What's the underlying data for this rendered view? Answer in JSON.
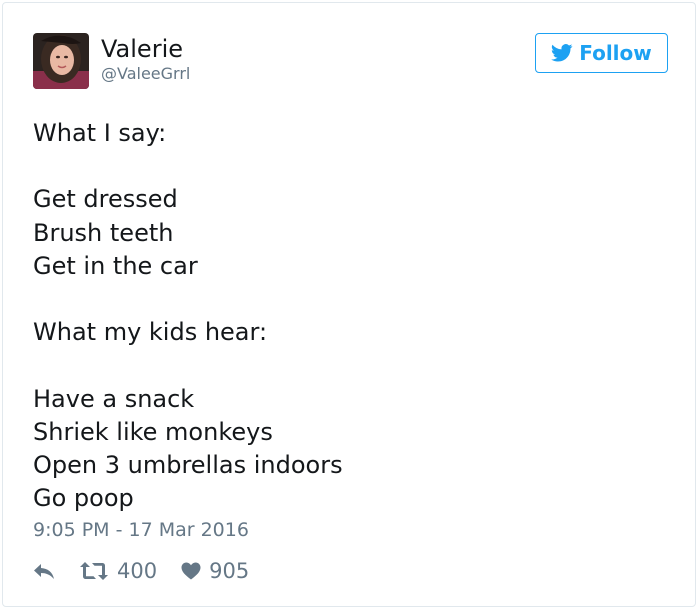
{
  "colors": {
    "accent": "#1da1f2",
    "text": "#14171a",
    "muted": "#657786",
    "border": "#e1e8ed"
  },
  "user": {
    "display_name": "Valerie",
    "handle": "@ValeeGrrl"
  },
  "follow_button": {
    "label": "Follow",
    "icon": "twitter-bird-icon"
  },
  "tweet": {
    "lines": [
      "What I say:",
      "",
      "Get dressed",
      "Brush teeth",
      "Get in the car",
      "",
      "What my kids hear:",
      "",
      "Have a snack",
      "Shriek like monkeys",
      "Open 3 umbrellas indoors",
      "Go poop"
    ],
    "timestamp": "9:05 PM - 17 Mar 2016"
  },
  "actions": {
    "reply_icon": "reply-icon",
    "retweet_icon": "retweet-icon",
    "retweet_count": "400",
    "like_icon": "heart-icon",
    "like_count": "905"
  }
}
